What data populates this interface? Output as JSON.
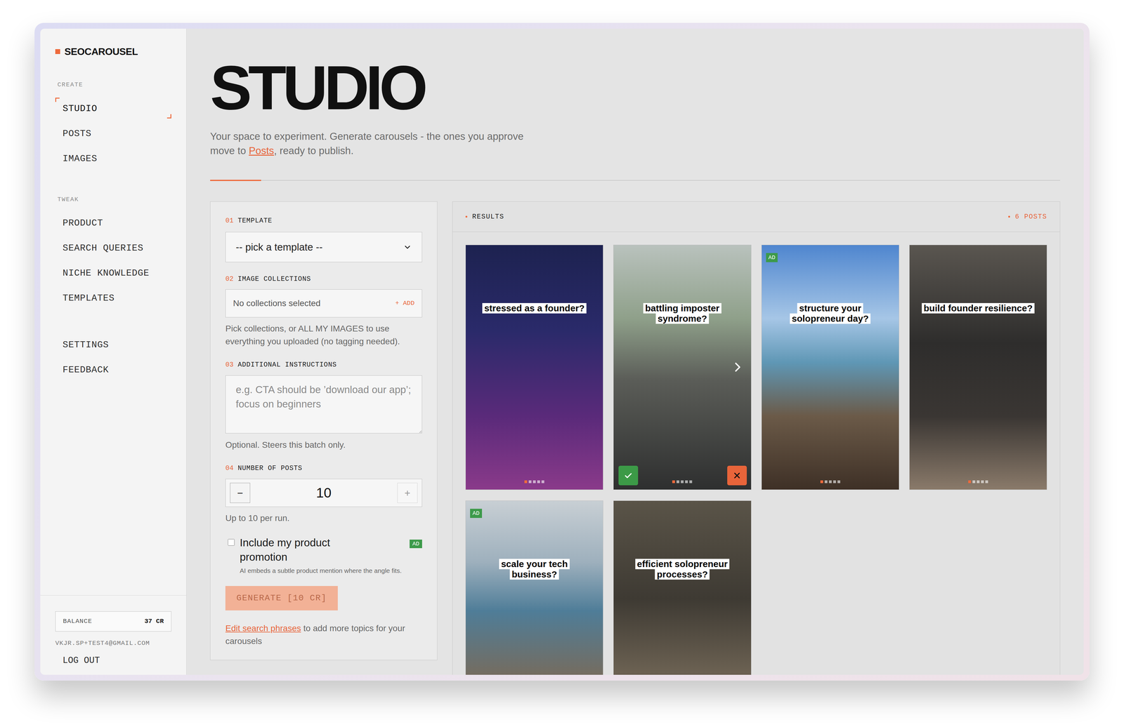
{
  "brand": {
    "name": "SEOCAROUSEL"
  },
  "sidebar": {
    "sections": [
      {
        "label": "CREATE",
        "items": [
          {
            "label": "STUDIO",
            "selected": true
          },
          {
            "label": "POSTS",
            "selected": false
          },
          {
            "label": "IMAGES",
            "selected": false
          }
        ]
      },
      {
        "label": "TWEAK",
        "items": [
          {
            "label": "PRODUCT",
            "selected": false
          },
          {
            "label": "SEARCH QUERIES",
            "selected": false
          },
          {
            "label": "NICHE KNOWLEDGE",
            "selected": false
          },
          {
            "label": "TEMPLATES",
            "selected": false
          }
        ]
      },
      {
        "items": [
          {
            "label": "SETTINGS",
            "selected": false
          },
          {
            "label": "FEEDBACK",
            "selected": false
          }
        ]
      }
    ]
  },
  "account": {
    "balance_label": "BALANCE",
    "balance": "37 CR",
    "email": "VKJR.SP+TEST4@GMAIL.COM",
    "logout": "LOG OUT"
  },
  "page": {
    "title": "STUDIO",
    "subtitle_before": "Your space to experiment. Generate carousels - the ones you approve move to ",
    "subtitle_link": "Posts",
    "subtitle_after": ", ready to publish."
  },
  "form": {
    "template": {
      "number": "01",
      "label": "TEMPLATE",
      "value": "-- pick a template --"
    },
    "collections": {
      "number": "02",
      "label": "IMAGE COLLECTIONS",
      "value": "No collections selected",
      "add": "+ ADD",
      "help": "Pick collections, or ALL MY IMAGES to use everything you uploaded (no tagging needed)."
    },
    "instructions": {
      "number": "03",
      "label": "ADDITIONAL INSTRUCTIONS",
      "placeholder": "e.g. CTA should be ’download our app’; focus on beginners",
      "help": "Optional. Steers this batch only."
    },
    "count": {
      "number": "04",
      "label": "NUMBER OF POSTS",
      "minus": "−",
      "value": "10",
      "plus": "+",
      "help": "Up to 10 per run."
    },
    "promotion": {
      "label": "Include my product promotion",
      "checked": false,
      "badge": "AD",
      "help": "AI embeds a subtle product mention where the angle fits."
    },
    "generate": {
      "label": "GENERATE [10 CR]",
      "disabled": true
    },
    "footer": {
      "link": "Edit search phrases",
      "text": " to add more topics for your carousels"
    }
  },
  "results": {
    "label": "RESULTS",
    "count": "6 POSTS",
    "cards": [
      {
        "lines": [
          "stressed as a founder?"
        ],
        "ad": false,
        "slides": 5,
        "current_slide": 0,
        "actions": false
      },
      {
        "lines": [
          "battling imposter",
          "syndrome?"
        ],
        "ad": false,
        "slides": 5,
        "current_slide": 0,
        "actions": true
      },
      {
        "lines": [
          "structure your",
          "solopreneur day?"
        ],
        "ad": true,
        "ad_label": "AD",
        "slides": 5,
        "current_slide": 0,
        "actions": false
      },
      {
        "lines": [
          "build founder resilience?"
        ],
        "ad": false,
        "slides": 5,
        "current_slide": 0,
        "actions": false
      },
      {
        "lines": [
          "scale your tech",
          "business?"
        ],
        "ad": true,
        "ad_label": "AD",
        "actions": false
      },
      {
        "lines": [
          "efficient solopreneur",
          "processes?"
        ],
        "ad": false,
        "actions": false
      }
    ]
  }
}
